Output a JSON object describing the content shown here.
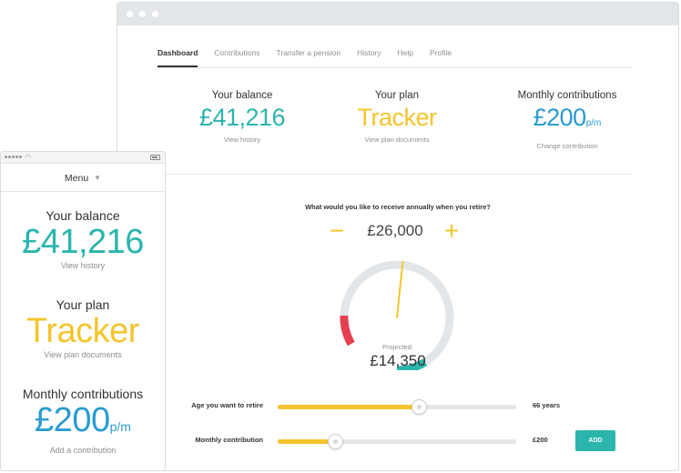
{
  "desktop": {
    "nav": [
      {
        "label": "Dashboard",
        "active": true
      },
      {
        "label": "Contributions",
        "active": false
      },
      {
        "label": "Transfer a pension",
        "active": false
      },
      {
        "label": "History",
        "active": false
      },
      {
        "label": "Help",
        "active": false
      },
      {
        "label": "Profile",
        "active": false
      }
    ],
    "balance": {
      "title": "Your balance",
      "value": "£41,216",
      "link": "View history"
    },
    "plan": {
      "title": "Your plan",
      "value": "Tracker",
      "link": "View plan documents"
    },
    "contributions": {
      "title": "Monthly contributions",
      "value": "£200",
      "unit": "p/m",
      "link": "Change contribution"
    },
    "retire": {
      "question": "What would you like to receive annually when you retire?",
      "minus": "−",
      "plus": "+",
      "target": "£26,000",
      "projected_label": "Projected:",
      "projected_value": "£14,350",
      "gauge_needle_fraction": 0.42
    },
    "sliders": {
      "age": {
        "label": "Age you want to retire",
        "value": "66 years",
        "fraction": 0.59
      },
      "contribution": {
        "label": "Monthly contribution",
        "value": "£200",
        "fraction": 0.24,
        "button": "ADD"
      }
    }
  },
  "mobile": {
    "menu": "Menu",
    "balance": {
      "title": "Your balance",
      "value": "£41,216",
      "link": "View history"
    },
    "plan": {
      "title": "Your plan",
      "value": "Tracker",
      "link": "View plan documents"
    },
    "contributions": {
      "title": "Monthly contributions",
      "value": "£200",
      "unit": "p/m",
      "link": "Add a contribution"
    }
  },
  "colors": {
    "teal": "#2bb5ad",
    "yellow": "#f4c52c",
    "blue": "#2a9bd0",
    "red": "#e5404f",
    "track": "#e3e6e9"
  },
  "icons": [
    "minus-icon",
    "plus-icon",
    "wifi-icon",
    "battery-icon",
    "chevron-down-icon"
  ]
}
